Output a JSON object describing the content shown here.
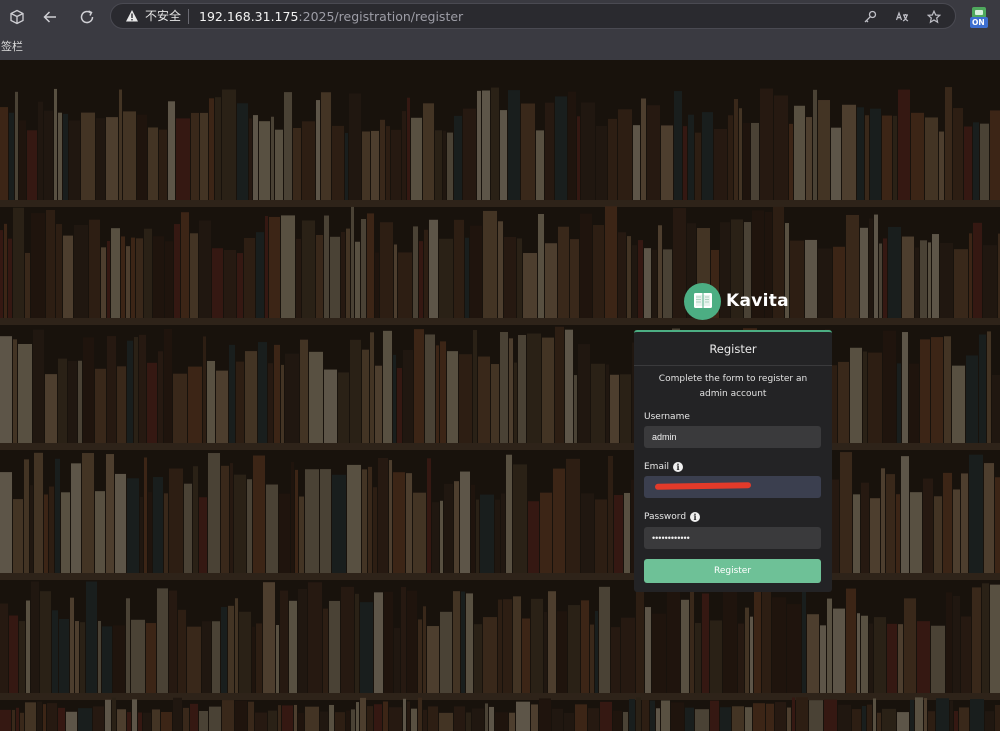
{
  "browser": {
    "security_label": "不安全",
    "url_host": "192.168.31.175",
    "url_path": ":2025/registration/register",
    "bookmarks_bar_label": "签栏",
    "extension_badge": "ON",
    "icons": {
      "tabs": "tab-overview-icon",
      "back": "arrow-left-icon",
      "reload": "reload-icon",
      "warning": "warning-triangle-icon",
      "password": "key-icon",
      "translate": "translate-icon",
      "bookmark": "star-icon",
      "extension": "extension-icon"
    }
  },
  "brand": {
    "name": "Kavita",
    "logo_icon": "book-icon",
    "accent_color": "#4cae83"
  },
  "register_card": {
    "title": "Register",
    "description": "Complete the form to register an admin account",
    "username": {
      "label": "Username",
      "value": "admin"
    },
    "email": {
      "label": "Email",
      "value": "",
      "info_icon": "info-icon"
    },
    "password": {
      "label": "Password",
      "value": "••••••••••••",
      "info_icon": "info-icon"
    },
    "submit_label": "Register"
  },
  "background": {
    "image": "library-bookshelf",
    "tint": "#261d15"
  }
}
